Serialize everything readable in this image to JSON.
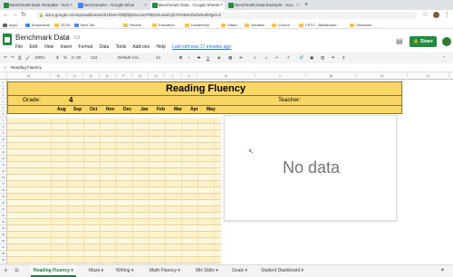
{
  "browser": {
    "tabs": [
      {
        "label": "Benchmark Data Template - Non",
        "fav": "#1e8e3e",
        "active": false
      },
      {
        "label": "Benchmarks - Google Drive",
        "fav": "#4285f4",
        "active": false
      },
      {
        "label": "Benchmark Data - Google Sheets",
        "fav": "#1e8e3e",
        "active": true
      },
      {
        "label": "Benchmark Data Example - Goo",
        "fav": "#1e8e3e",
        "active": false
      }
    ],
    "url": "docs.google.com/spreadsheets/d/1b9vnYl5ifjf8jZDuU1DPl0Z2Xuv8ZUjX7HOMH1bZW/edit#gid=0",
    "bookmarks": [
      "Apps",
      "Bookmarks",
      "SC25",
      "New Tab",
      "Fitness",
      "Education",
      "Leadership",
      "Visitio",
      "Vacation",
      "Church",
      "CPTC - Blackboard",
      "Housesitt"
    ]
  },
  "doc": {
    "title": "Benchmark Data",
    "menus": [
      "File",
      "Edit",
      "View",
      "Insert",
      "Format",
      "Data",
      "Tools",
      "Add-ons",
      "Help"
    ],
    "last_edit": "Last edit was 17 minutes ago",
    "share_label": "Share"
  },
  "toolbar": {
    "zoom": "100%",
    "currency": "$",
    "percent": "%",
    "decimals": ".0 .00",
    "format": "123",
    "font": "Default (Ari...",
    "font_size": "24",
    "bold": "B",
    "italic": "I",
    "strike": "S",
    "text_color": "A"
  },
  "formula": {
    "fx": "fx",
    "cell_ref": "",
    "content": "Reading Fluency"
  },
  "columns": [
    "A",
    "B",
    "C",
    "D",
    "E",
    "F",
    "G",
    "H",
    "I",
    "J",
    "K",
    "L",
    "M",
    "N",
    "O"
  ],
  "sheet": {
    "title": "Reading Fluency",
    "grade_label": "Grade:",
    "grade_value": "4",
    "teacher_label": "Teacher:",
    "months": [
      "Aug",
      "Sep",
      "Oct",
      "Nov",
      "Dec",
      "Jan",
      "Feb",
      "Mar",
      "Apr",
      "May"
    ],
    "row_numbers": [
      "1",
      "2",
      "3",
      "4",
      "5",
      "6",
      "7",
      "8",
      "9",
      "10",
      "11",
      "12",
      "13",
      "14",
      "15",
      "16",
      "17",
      "18",
      "19",
      "20",
      "21",
      "22",
      "23",
      "24",
      "25",
      "26",
      "27",
      "28",
      "29",
      "30"
    ]
  },
  "chart": {
    "empty_text": "No data"
  },
  "sheet_tabs": [
    "Reading Fluency",
    "Maze",
    "Writing",
    "Math Fluency",
    "Mix Skills",
    "Goals",
    "Student Dashboard"
  ],
  "colors": {
    "accent": "#fad764",
    "share": "#1e8e3e",
    "active_tab": "#188038"
  }
}
